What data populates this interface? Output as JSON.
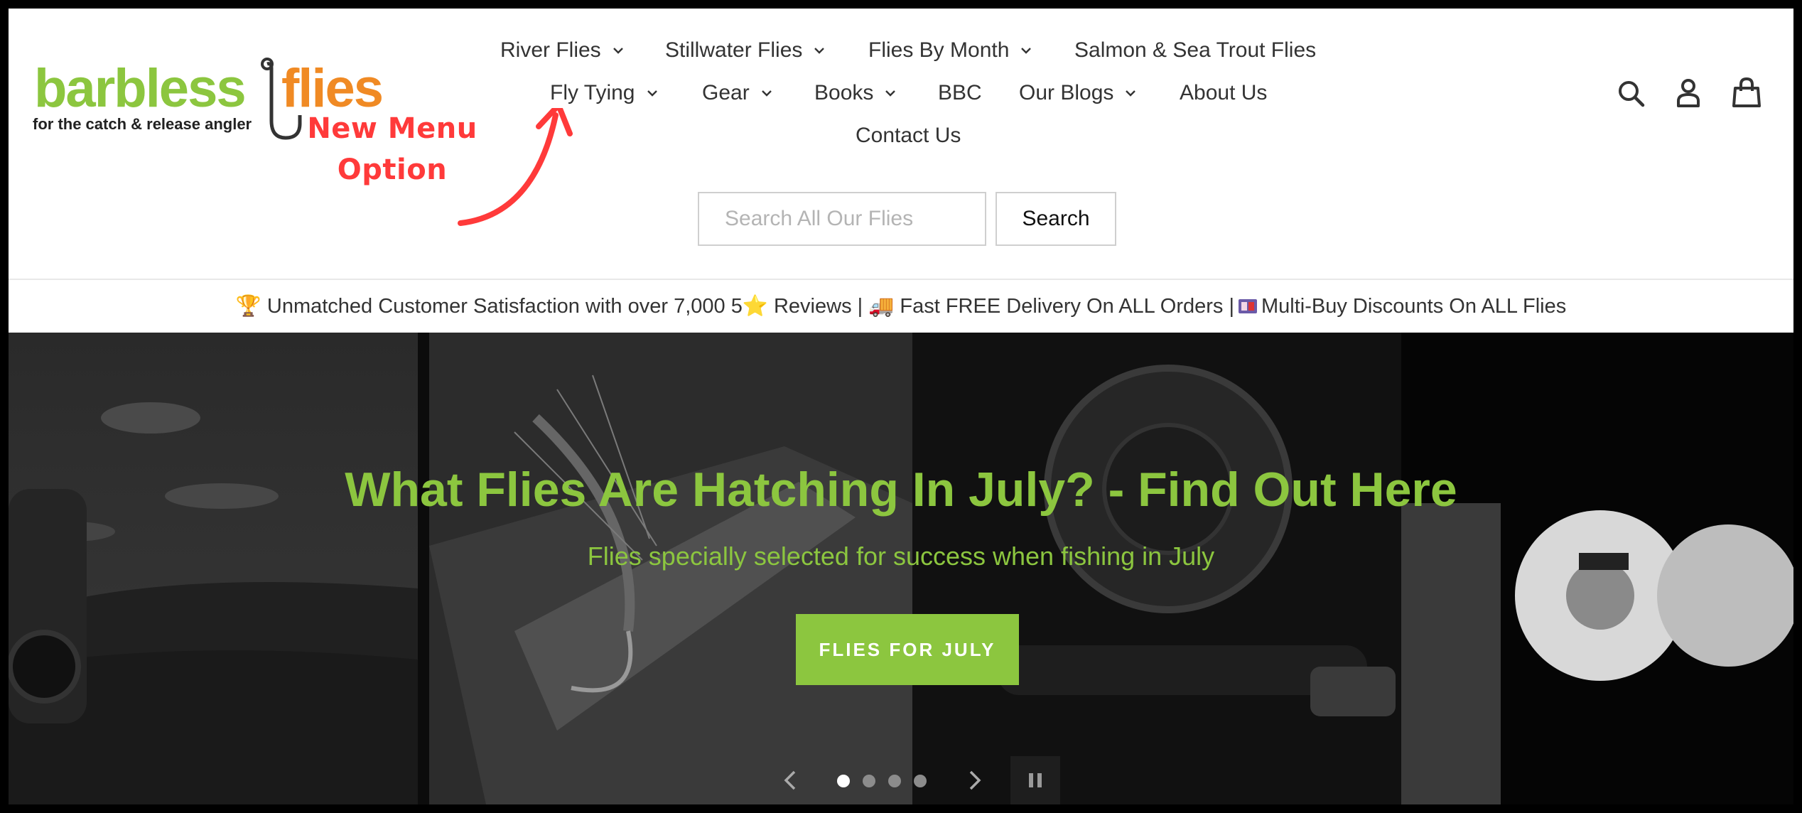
{
  "logo": {
    "brand_left": "barbless",
    "brand_right": "flies",
    "tagline": "for the catch & release angler"
  },
  "nav": {
    "row1": [
      "River Flies",
      "Stillwater Flies",
      "Flies By Month",
      "Salmon & Sea Trout Flies"
    ],
    "row2": [
      "Fly Tying",
      "Gear",
      "Books",
      "BBC",
      "Our Blogs",
      "About Us"
    ],
    "row3": [
      "Contact Us"
    ]
  },
  "header_icons": [
    "search-icon",
    "account-icon",
    "cart-icon"
  ],
  "annotation": {
    "line1": "New Menu",
    "line2": "Option",
    "color": "#ff3a3a"
  },
  "search": {
    "placeholder": "Search All Our Flies",
    "button_label": "Search"
  },
  "announcement": {
    "part1": "🏆 Unmatched Customer Satisfaction with over 7,000 5⭐ Reviews | 🚚 Fast FREE Delivery On ALL Orders | ",
    "part2": " Multi-Buy Discounts On ALL Flies"
  },
  "hero": {
    "title": "What Flies Are Hatching In July? - Find Out Here",
    "subtitle": "Flies specially selected for success when fishing in July",
    "cta_label": "FLIES FOR JULY",
    "slide_count": 4,
    "active_slide": 1
  },
  "colors": {
    "accent": "#8cc63f",
    "logo_green": "#8cc63f",
    "logo_orange": "#f08a24",
    "text": "#333333",
    "frame": "#000000"
  }
}
